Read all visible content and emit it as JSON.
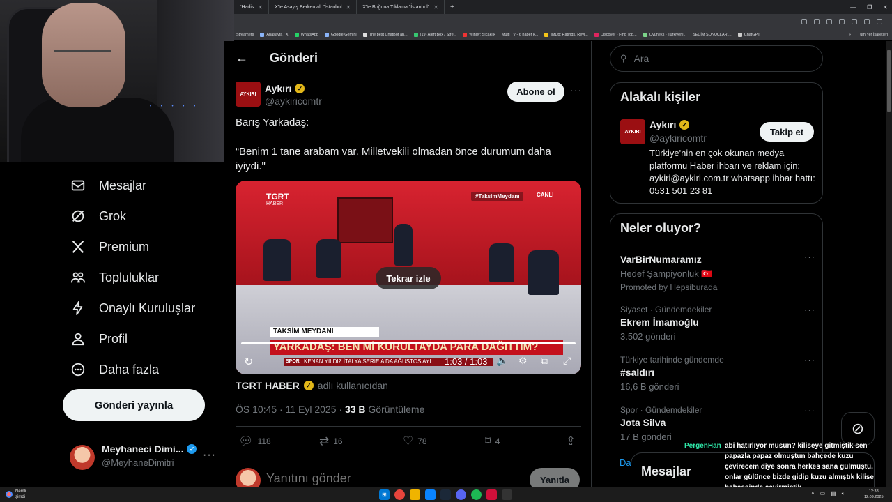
{
  "browser": {
    "tabs": [
      {
        "label": "\"Hadis"
      },
      {
        "label": "X'te Asayiş Berkemal: \"İstanbul"
      },
      {
        "label": "X'te Boğuna Tıklama \"İstanbul\""
      }
    ],
    "bookmarks": [
      "Streamers",
      "Anasayfa / X",
      "WhatsApp",
      "Google Gemini",
      "The best ChatBot an...",
      "(19) Alert Box / Stre...",
      "Windy: Sıcaklık",
      "Multi TV - 6 haber k...",
      "IMDb: Ratings, Revi...",
      "Discover - Find Top...",
      "Oyuneks - Türkiyeni...",
      "SEÇİM SONUÇLARI...",
      "ChatGPT"
    ],
    "bookmarks_more": "»",
    "all_bookmarks": "Tüm Yer İşaretleri"
  },
  "nav": {
    "items": [
      {
        "label": "Mesajlar",
        "icon": "envelope-icon"
      },
      {
        "label": "Grok",
        "icon": "grok-icon"
      },
      {
        "label": "Premium",
        "icon": "x-logo-icon"
      },
      {
        "label": "Topluluklar",
        "icon": "people-icon"
      },
      {
        "label": "Onaylı Kuruluşlar",
        "icon": "lightning-icon"
      },
      {
        "label": "Profil",
        "icon": "person-icon"
      },
      {
        "label": "Daha fazla",
        "icon": "more-circle-icon"
      }
    ],
    "post_button": "Gönderi yayınla",
    "account": {
      "name": "Meyhaneci Dimi...",
      "handle": "@MeyhaneDimitri",
      "more": "···"
    }
  },
  "main": {
    "title": "Gönderi",
    "back": "←",
    "author": {
      "name": "Aykırı",
      "handle": "@aykiricomtr",
      "avatar_text": "AYKIRI"
    },
    "subscribe": "Abone ol",
    "more": "···",
    "text": "Barış Yarkadaş:\n\n“Benim 1 tane arabam var. Milletvekili olmadan önce durumum daha iyiydi.\"",
    "video": {
      "channel": "TGRT",
      "channel_sub": "HABER",
      "hashtag": "#TaksimMeydanı",
      "live": "CANLI",
      "lower_third_1": "TAKSİM MEYDANI",
      "lower_third_2": "YARKADAŞ: BEN Mİ KURULTAYDA PARA DAĞITTIM?",
      "ticker_label": "SPOR",
      "ticker": "KENAN YILDIZ İTALYA SERIE A'DA AĞUSTOS AYI",
      "replay_label": "Tekrar izle",
      "time": "1:03 / 1:03",
      "progress": 1.0
    },
    "source": {
      "name": "TGRT HABER",
      "suffix": "adlı kullanıcıdan"
    },
    "meta": {
      "time": "ÖS 10:45 · 11 Eyl 2025 · ",
      "views": "33 B",
      "views_label": " Görüntüleme"
    },
    "actions": {
      "replies": "118",
      "reposts": "16",
      "likes": "78",
      "bookmarks": "4"
    },
    "reply": {
      "placeholder": "Yanıtını gönder",
      "button": "Yanıtla"
    }
  },
  "sidebar": {
    "search_placeholder": "Ara",
    "related": {
      "title": "Alakalı kişiler",
      "name": "Aykırı",
      "handle": "@aykiricomtr",
      "avatar_text": "AYKIRI",
      "follow": "Takip et",
      "bio": "Türkiye'nin en çok okunan medya platformu Haber ihbarı ve reklam için: aykiri@aykiri.com.tr whatsapp ihbar hattı: 0531 501 23 81"
    },
    "trending": {
      "title": "Neler oluyor?",
      "items": [
        {
          "category": "",
          "title": "VarBirNumaramız",
          "sub": "Hedef Şampiyonluk 🇹🇷",
          "promo": "Promoted by Hepsiburada"
        },
        {
          "category": "Siyaset · Gündemdekiler",
          "title": "Ekrem İmamoğlu",
          "sub": "3.502 gönderi"
        },
        {
          "category": "Türkiye tarihinde gündemde",
          "title": "#saldırı",
          "sub": "16,6 B gönderi"
        },
        {
          "category": "Spor · Gündemdekiler",
          "title": "Jota Silva",
          "sub": "17 B gönderi"
        }
      ],
      "more_link": "Da"
    },
    "messages_drawer": "Mesajlar"
  },
  "stream_chat": {
    "user": "PergenHan",
    "message": "abi hatırlıyor musun? kiliseye gitmiştik sen papazla papaz olmuştun bahçede kuzu çevirecem diye sonra herkes sana gülmüştü. onlar gülünce bizde gidip kuzu almıştık kilise bahçesinde çevirmiştik"
  },
  "taskbar": {
    "weather_title": "Nemli",
    "weather_sub": "şimdi",
    "time": "12:38",
    "date": "12.09.2025"
  },
  "colors": {
    "accent": "#1d9bf0",
    "verified_gold": "#e2b719",
    "verified_blue": "#1d9bf0",
    "brand_red": "#9b0f12"
  }
}
